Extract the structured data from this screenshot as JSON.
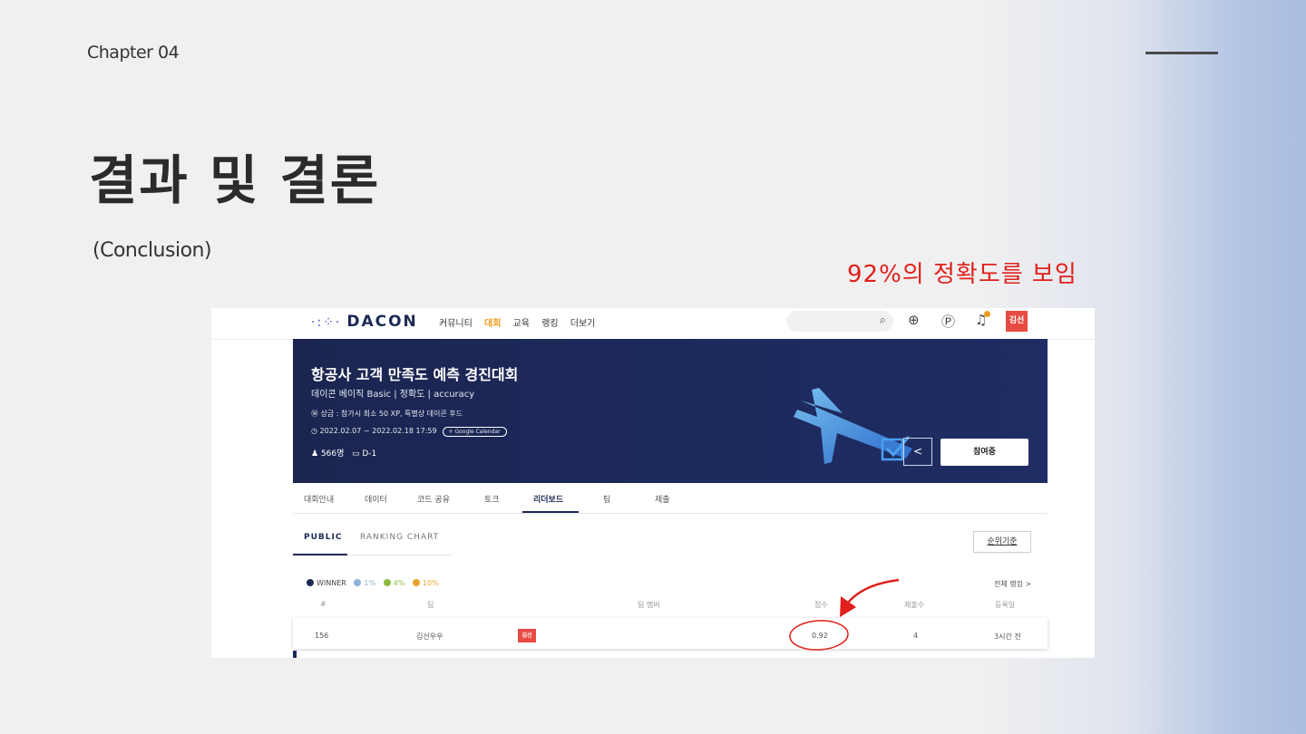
{
  "slide": {
    "chapter": "Chapter 04",
    "title": "결과 및 결론",
    "subtitle": "(Conclusion)",
    "note": "92%의 정확도를 보임",
    "note_color": "#e0201b"
  },
  "site": {
    "logo": "DACON",
    "menu": [
      "커뮤니티",
      "대회",
      "교육",
      "랭킹",
      "더보기"
    ],
    "active_menu": "대회",
    "user_badge": "김선",
    "accent": "#f29b1d"
  },
  "banner": {
    "title": "항공사 고객 만족도 예측 경진대회",
    "subtitle": "데이콘 베이직 Basic | 정확도 | accuracy",
    "prize": "상금 : 참가시 최소 50 XP, 특별상 데이콘 후드",
    "period": "2022.02.07 ~ 2022.02.18 17:59",
    "calendar_btn": "+ Google Calendar",
    "participants": "566명",
    "dday": "D-1",
    "join_btn": "참여중",
    "bg_color": "#1d2a5e"
  },
  "tabs": [
    "대회안내",
    "데이터",
    "코드 공유",
    "토크",
    "리더보드",
    "팀",
    "제출"
  ],
  "active_tab": "리더보드",
  "leaderboard": {
    "subtabs": [
      "PUBLIC",
      "RANKING CHART"
    ],
    "active_subtab": "PUBLIC",
    "rank_basis_btn": "순위기준",
    "legend": [
      {
        "label": "WINNER",
        "color": "#1d2a55"
      },
      {
        "label": "1%",
        "color": "#8fb0d8"
      },
      {
        "label": "4%",
        "color": "#8dbb3f"
      },
      {
        "label": "10%",
        "color": "#e9a52b"
      }
    ],
    "all_ranking": "전체 랭킹 >",
    "headers": [
      "#",
      "팀",
      "팀 멤버",
      "점수",
      "제출수",
      "등록일"
    ],
    "row": {
      "rank": "156",
      "team": "김선우우",
      "member_badge": "김선",
      "score": "0.92",
      "submissions": "4",
      "date": "3시간 전"
    }
  }
}
